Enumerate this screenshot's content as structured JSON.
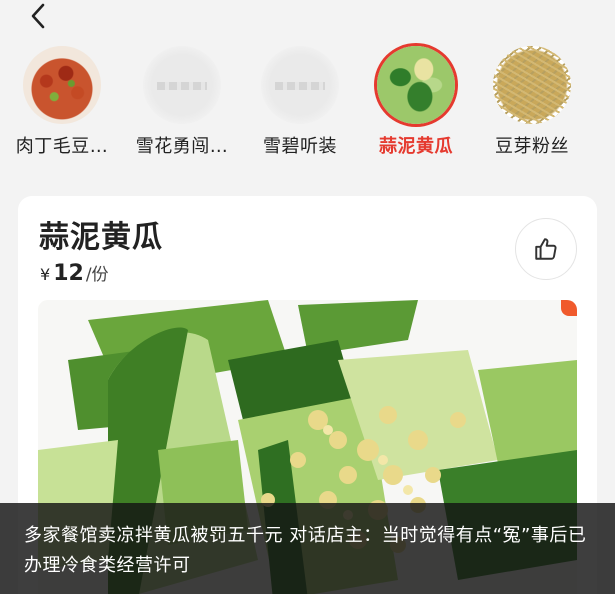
{
  "nav": {
    "back_icon": "chevron-left-icon"
  },
  "categories": [
    {
      "label": "肉丁毛豆…",
      "thumb": "diced-meat-edamame",
      "selected": false
    },
    {
      "label": "雪花勇闯…",
      "thumb": "blurred",
      "selected": false
    },
    {
      "label": "雪碧听装",
      "thumb": "blurred",
      "selected": false
    },
    {
      "label": "蒜泥黄瓜",
      "thumb": "garlic-cucumber",
      "selected": true
    },
    {
      "label": "豆芽粉丝",
      "thumb": "bean-sprout-vermicelli",
      "selected": false
    }
  ],
  "dish": {
    "title": "蒜泥黄瓜",
    "price_symbol": "¥",
    "price_value": "12",
    "price_unit": "/份",
    "like_icon": "thumbs-up-icon"
  },
  "caption": {
    "text": "多家餐馆卖凉拌黄瓜被罚五千元  对话店主：当时觉得有点“冤”事后已办理冷食类经营许可"
  },
  "colors": {
    "accent": "#e53a2f",
    "background": "#f3f3f3",
    "caption_bg": "#141414"
  }
}
